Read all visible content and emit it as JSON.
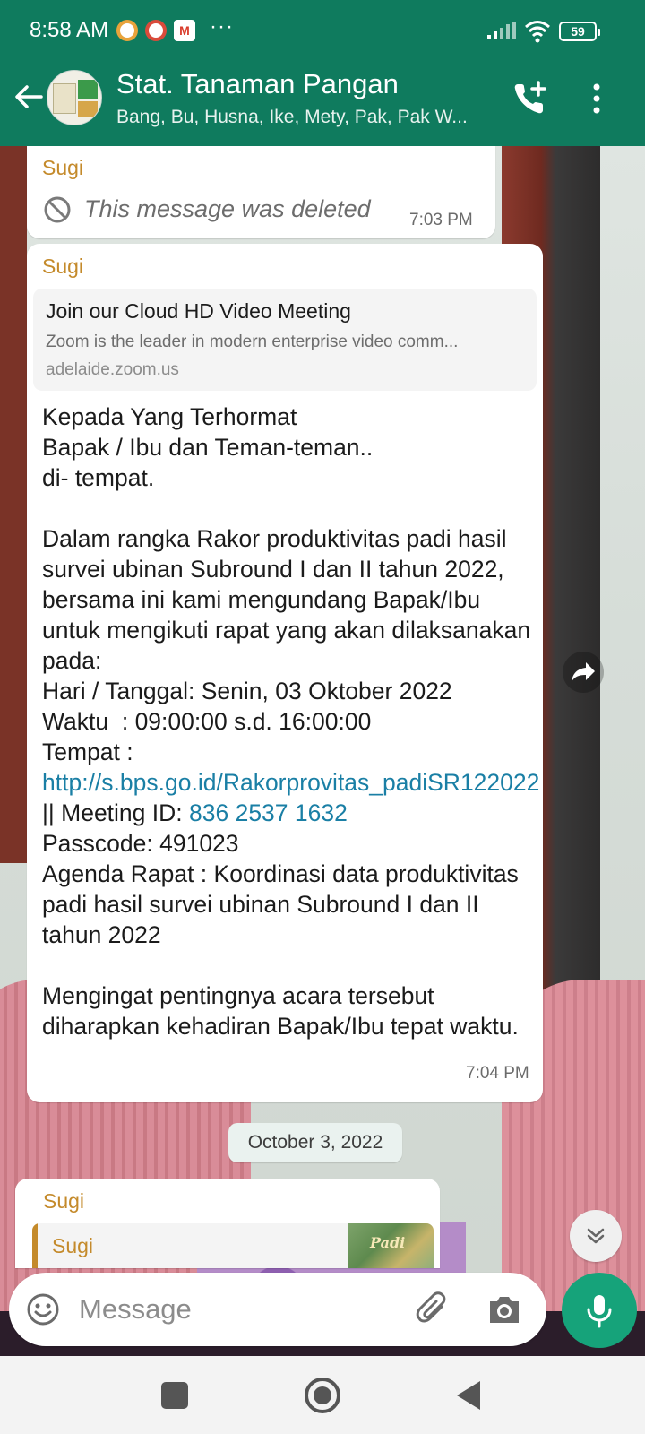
{
  "status_bar": {
    "time": "8:58 AM",
    "notification_icons": [
      "chrome-icon",
      "chrome-icon",
      "gmail-icon"
    ],
    "more": "···",
    "battery": "59"
  },
  "header": {
    "title": "Stat. Tanaman Pangan",
    "subtitle": "Bang, Bu, Husna, Ike, Mety, Pak, Pak W...",
    "accent_color": "#0f7b5e"
  },
  "messages": [
    {
      "sender": "Sugi",
      "deleted_text": "This message was deleted",
      "time": "7:03 PM"
    },
    {
      "sender": "Sugi",
      "link_preview": {
        "title": "Join our Cloud HD Video Meeting",
        "description": "Zoom is the leader in modern enterprise video comm...",
        "domain": "adelaide.zoom.us"
      },
      "body_part1": "Kepada Yang Terhormat\nBapak / Ibu dan Teman-teman..\ndi- tempat.\n\nDalam rangka Rakor produktivitas padi hasil survei ubinan Subround I dan II tahun 2022, bersama ini kami mengundang Bapak/Ibu untuk mengikuti rapat yang akan dilaksanakan pada:\nHari / Tanggal: Senin, 03 Oktober 2022\nWaktu  : 09:00:00 s.d. 16:00:00\nTempat : ",
      "link_url": "http://s.bps.go.id/Rakorprovitas_padiSR122022",
      "body_part2": " || Meeting ID: ",
      "meeting_id": "836 2537 1632",
      "body_part3": "\nPasscode: 491023\nAgenda Rapat : Koordinasi data produktivitas padi hasil survei ubinan Subround I dan II tahun 2022\n\nMengingat pentingnya acara tersebut diharapkan kehadiran Bapak/Ibu tepat waktu.",
      "time": "7:04 PM",
      "link_color": "#1a7fa5"
    }
  ],
  "date_chip": "October 3, 2022",
  "partial_message": {
    "sender": "Sugi",
    "quoted_sender": "Sugi",
    "thumb_text": "Padi"
  },
  "composer": {
    "placeholder": "Message"
  },
  "sender_color": "#c48a2b"
}
